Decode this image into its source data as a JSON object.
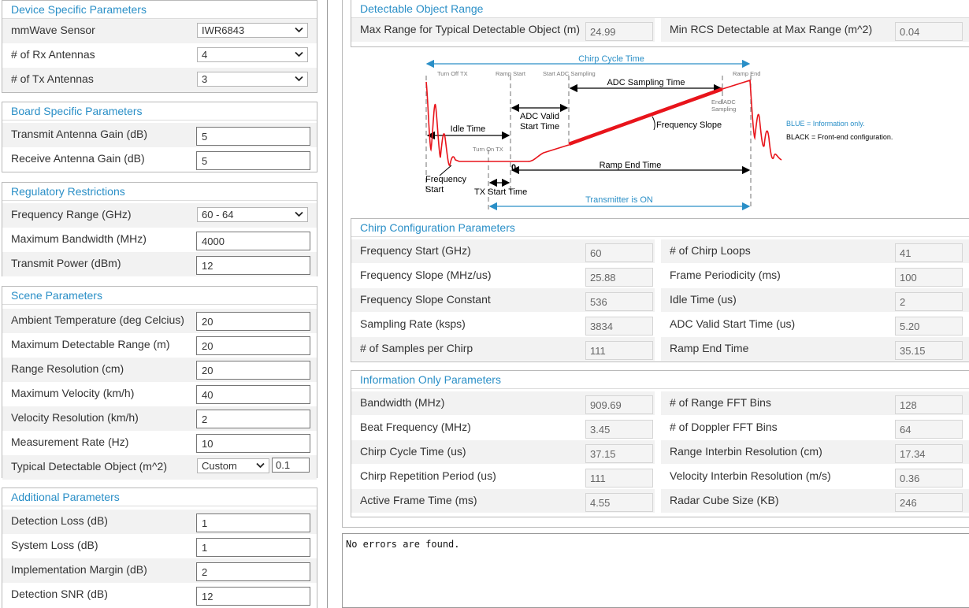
{
  "device": {
    "title": "Device Specific Parameters",
    "sensor_label": "mmWave Sensor",
    "sensor_value": "IWR6843",
    "rx_label": "# of Rx Antennas",
    "rx_value": "4",
    "tx_label": "# of Tx Antennas",
    "tx_value": "3"
  },
  "board": {
    "title": "Board Specific Parameters",
    "tx_gain_label": "Transmit Antenna Gain (dB)",
    "tx_gain_value": "5",
    "rx_gain_label": "Receive Antenna Gain (dB)",
    "rx_gain_value": "5"
  },
  "regulatory": {
    "title": "Regulatory Restrictions",
    "freq_label": "Frequency Range (GHz)",
    "freq_value": "60 - 64",
    "bw_label": "Maximum Bandwidth (MHz)",
    "bw_value": "4000",
    "power_label": "Transmit Power (dBm)",
    "power_value": "12"
  },
  "scene": {
    "title": "Scene Parameters",
    "temp_label": "Ambient Temperature (deg Celcius)",
    "temp_value": "20",
    "range_label": "Maximum Detectable Range (m)",
    "range_value": "20",
    "rres_label": "Range Resolution (cm)",
    "rres_value": "20",
    "vel_label": "Maximum Velocity (km/h)",
    "vel_value": "40",
    "vres_label": "Velocity Resolution (km/h)",
    "vres_value": "2",
    "rate_label": "Measurement Rate (Hz)",
    "rate_value": "10",
    "obj_label": "Typical Detectable Object (m^2)",
    "obj_select": "Custom",
    "obj_value": "0.1"
  },
  "additional": {
    "title": "Additional Parameters",
    "det_loss_label": "Detection Loss (dB)",
    "det_loss_value": "1",
    "sys_loss_label": "System Loss (dB)",
    "sys_loss_value": "1",
    "impl_label": "Implementation Margin (dB)",
    "impl_value": "2",
    "snr_label": "Detection SNR (dB)",
    "snr_value": "12"
  },
  "detectable": {
    "title": "Detectable Object Range",
    "max_range_label": "Max Range for Typical Detectable Object (m)",
    "max_range_value": "24.99",
    "min_rcs_label": "Min RCS Detectable at Max Range (m^2)",
    "min_rcs_value": "0.04"
  },
  "diagram": {
    "chirp_cycle": "Chirp Cycle Time",
    "turn_off_tx": "Turn Off TX",
    "ramp_start": "Ramp Start",
    "start_adc": "Start ADC Sampling",
    "ramp_end": "Ramp End",
    "adc_sampling_time": "ADC Sampling Time",
    "end_adc_1": "End ADC",
    "end_adc_2": "Sampling",
    "adc_valid_1": "ADC Valid",
    "adc_valid_2": "Start Time",
    "idle_time": "Idle Time",
    "freq_slope": "Frequency Slope",
    "turn_on_tx": "Turn On TX",
    "zero": "0",
    "ramp_end_time": "Ramp End Time",
    "freq_start_1": "Frequency",
    "freq_start_2": "Start",
    "tx_start_time": "TX Start Time",
    "tx_on": "Transmitter is ON",
    "legend_blue": "BLUE = Information only.",
    "legend_black": "BLACK = Front-end configuration.",
    "blue": "#2a8fc7",
    "red": "#e8141b"
  },
  "chirp": {
    "title": "Chirp Configuration Parameters",
    "freq_start_label": "Frequency Start (GHz)",
    "freq_start_value": "60",
    "slope_label": "Frequency Slope (MHz/us)",
    "slope_value": "25.88",
    "slope_const_label": "Frequency Slope Constant",
    "slope_const_value": "536",
    "sampling_label": "Sampling Rate (ksps)",
    "sampling_value": "3834",
    "samples_label": "# of Samples per Chirp",
    "samples_value": "111",
    "loops_label": "# of Chirp Loops",
    "loops_value": "41",
    "frame_label": "Frame Periodicity (ms)",
    "frame_value": "100",
    "idle_label": "Idle Time (us)",
    "idle_value": "2",
    "adc_valid_label": "ADC Valid Start Time (us)",
    "adc_valid_value": "5.20",
    "ramp_end_label": "Ramp End Time",
    "ramp_end_value": "35.15"
  },
  "info": {
    "title": "Information Only Parameters",
    "bw_label": "Bandwidth (MHz)",
    "bw_value": "909.69",
    "beat_label": "Beat Frequency (MHz)",
    "beat_value": "3.45",
    "cycle_label": "Chirp Cycle Time (us)",
    "cycle_value": "37.15",
    "rep_label": "Chirp Repetition Period (us)",
    "rep_value": "111",
    "active_label": "Active Frame Time (ms)",
    "active_value": "4.55",
    "range_fft_label": "# of Range FFT Bins",
    "range_fft_value": "128",
    "doppler_fft_label": "# of Doppler FFT Bins",
    "doppler_fft_value": "64",
    "range_interbin_label": "Range Interbin Resolution (cm)",
    "range_interbin_value": "17.34",
    "vel_interbin_label": "Velocity Interbin Resolution (m/s)",
    "vel_interbin_value": "0.36",
    "cube_label": "Radar Cube Size (KB)",
    "cube_value": "246"
  },
  "console": {
    "message": "No errors are found."
  }
}
